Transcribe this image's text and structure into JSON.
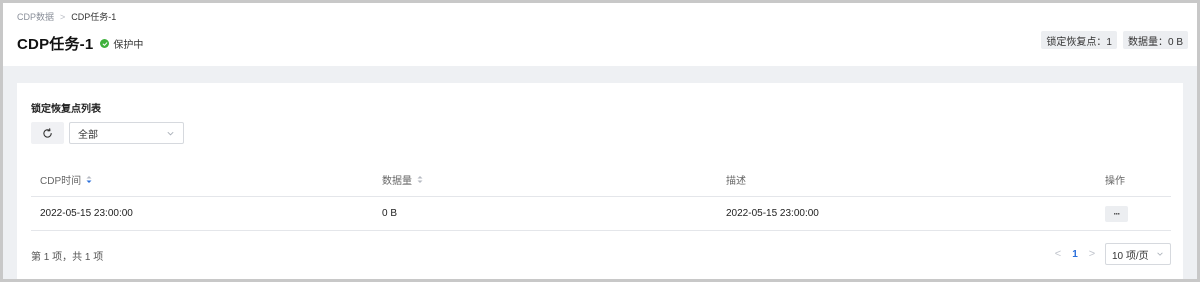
{
  "breadcrumb": {
    "parent": "CDP数据",
    "separator": ">",
    "current": "CDP任务-1"
  },
  "title": "CDP任务-1",
  "status": {
    "label": "保护中",
    "color": "#3fb13c",
    "icon": "check-circle-icon"
  },
  "stats": {
    "locked_points": "锁定恢复点：1",
    "data_size": "数据量：0 B"
  },
  "card": {
    "title": "锁定恢复点列表",
    "refresh_icon": "refresh-icon",
    "filter": {
      "selected": "全部"
    }
  },
  "table": {
    "columns": [
      "CDP时间",
      "数据量",
      "描述",
      "操作"
    ],
    "rows": [
      {
        "time": "2022-05-15 23:00:00",
        "size": "0 B",
        "description": "2022-05-15 23:00:00",
        "action": "···"
      }
    ]
  },
  "pagination": {
    "total_text": "第 1 项，共 1 项",
    "current_page": "1",
    "prev": "<",
    "next": ">",
    "page_size": "10 项/页"
  },
  "colors": {
    "accent": "#2a6fdb",
    "success": "#3fb13c",
    "page_bg": "#eef0f3"
  }
}
